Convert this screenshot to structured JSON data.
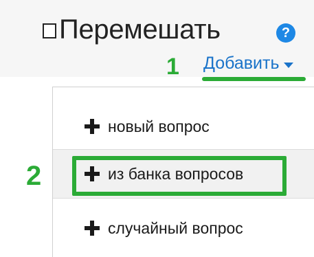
{
  "header": {
    "shuffle_label": "Перемешать",
    "help_icon_glyph": "?",
    "add_label": "Добавить"
  },
  "annotations": {
    "step_1": "1",
    "step_2": "2"
  },
  "add_menu": {
    "items": [
      {
        "label": "новый вопрос",
        "icon": "plus-icon"
      },
      {
        "label": "из банка вопросов",
        "icon": "plus-icon"
      },
      {
        "label": "случайный вопрос",
        "icon": "plus-icon"
      }
    ]
  },
  "colors": {
    "annotation_green": "#2bab36",
    "link_blue": "#1a73c9",
    "help_blue": "#1e88e5",
    "text": "#1a1a1a",
    "header_bg": "#f6f6f6",
    "hover_bg": "#f1f1f1"
  }
}
